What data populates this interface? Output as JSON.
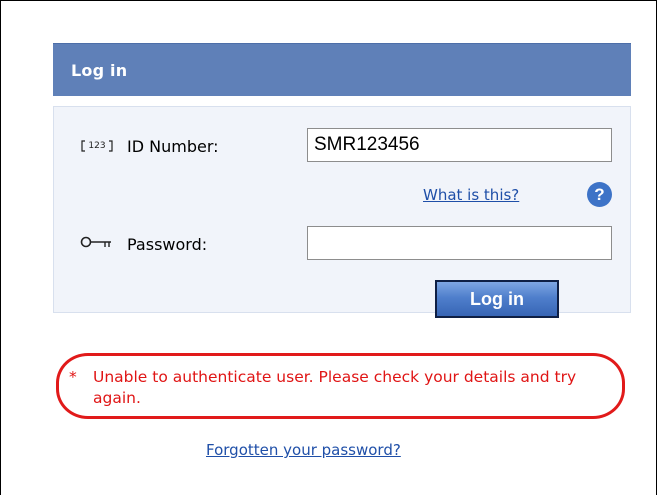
{
  "panel": {
    "title": "Log in"
  },
  "form": {
    "id_number": {
      "icon": "id-card-123-icon",
      "icon_text": "123",
      "label": "ID Number:",
      "value": "SMR123456"
    },
    "help": {
      "link_text": "What is this?",
      "icon_text": "?"
    },
    "password": {
      "icon": "key-icon",
      "label": "Password:",
      "value": ""
    },
    "submit_label": "Log in"
  },
  "error": {
    "marker": "*",
    "message": "Unable to authenticate user. Please check your details and try again."
  },
  "forgot_password_text": "Forgotten your password?",
  "colors": {
    "header_bg": "#5f80b8",
    "body_bg": "#f1f4fa",
    "error_red": "#e01515",
    "link_blue": "#1f4fa8"
  }
}
